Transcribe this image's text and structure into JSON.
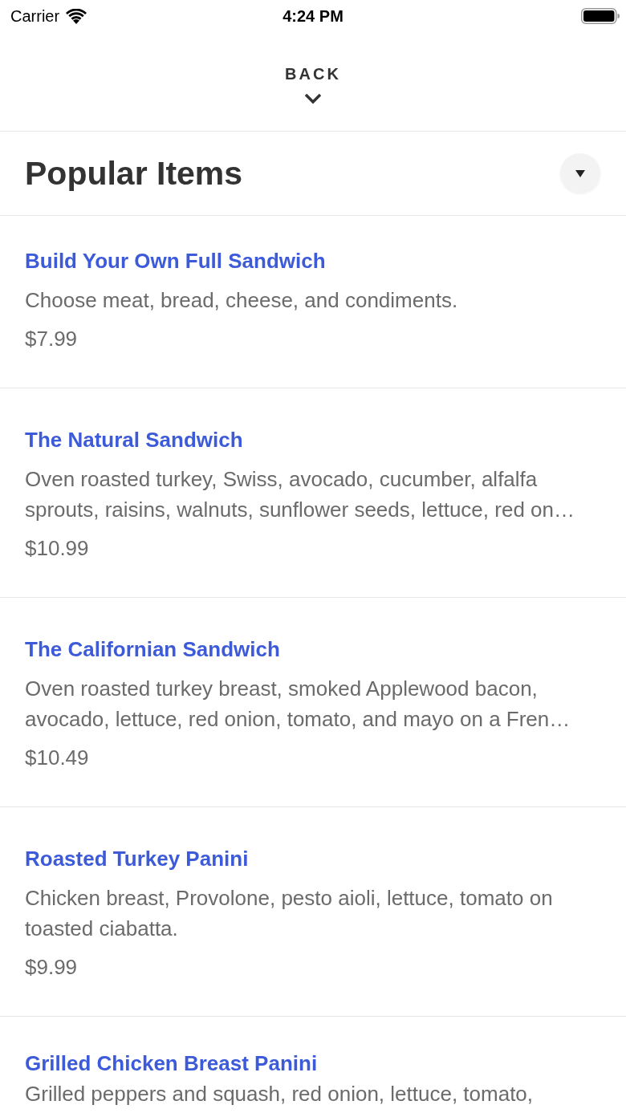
{
  "status_bar": {
    "carrier": "Carrier",
    "time": "4:24 PM"
  },
  "back_button": {
    "label": "BACK"
  },
  "section": {
    "title": "Popular Items"
  },
  "items": [
    {
      "name": "Build Your Own Full Sandwich",
      "description": "Choose meat, bread, cheese, and condiments.",
      "price": "$7.99"
    },
    {
      "name": "The Natural Sandwich",
      "description": "Oven roasted turkey, Swiss, avocado, cucumber, alfalfa sprouts, raisins, walnuts, sunflower seeds, lettuce, red on…",
      "price": "$10.99"
    },
    {
      "name": "The Californian Sandwich",
      "description": "Oven roasted turkey breast, smoked Applewood bacon, avocado, lettuce, red onion, tomato, and mayo on a Fren…",
      "price": "$10.49"
    },
    {
      "name": "Roasted Turkey Panini",
      "description": "Chicken breast, Provolone, pesto aioli, lettuce, tomato on toasted ciabatta.",
      "price": "$9.99"
    },
    {
      "name": "Grilled Chicken Breast Panini",
      "description": "Grilled peppers and squash, red onion, lettuce, tomato,"
    }
  ]
}
